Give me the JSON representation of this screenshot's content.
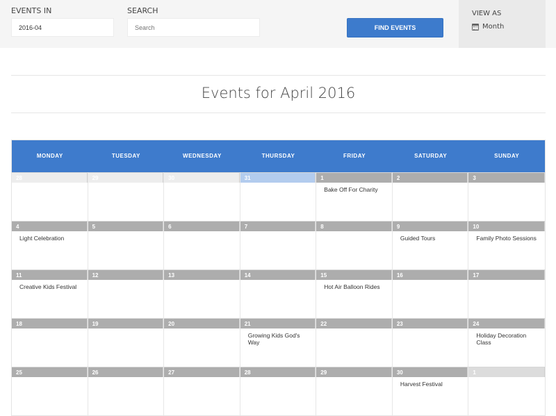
{
  "filter_bar": {
    "events_in_label": "EVENTS IN",
    "events_in_value": "2016-04",
    "search_label": "SEARCH",
    "search_placeholder": "Search",
    "find_button": "FIND EVENTS",
    "view_as_label": "VIEW AS",
    "view_as_value": "Month",
    "view_as_icon": "calendar-icon"
  },
  "page_title": "Events for April 2016",
  "colors": {
    "accent": "#3e7bcc",
    "day_header": "#adadad",
    "highlight": "#b3ccee"
  },
  "calendar": {
    "weekdays": [
      "MONDAY",
      "TUESDAY",
      "WEDNESDAY",
      "THURSDAY",
      "FRIDAY",
      "SATURDAY",
      "SUNDAY"
    ],
    "weeks": [
      [
        {
          "day": "28",
          "state": "other",
          "events": []
        },
        {
          "day": "29",
          "state": "other",
          "events": []
        },
        {
          "day": "30",
          "state": "other",
          "events": []
        },
        {
          "day": "31",
          "state": "prev-today",
          "events": []
        },
        {
          "day": "1",
          "state": "current",
          "events": [
            "Bake Off For Charity"
          ]
        },
        {
          "day": "2",
          "state": "current",
          "events": []
        },
        {
          "day": "3",
          "state": "current",
          "events": []
        }
      ],
      [
        {
          "day": "4",
          "state": "current",
          "events": [
            "Light Celebration"
          ]
        },
        {
          "day": "5",
          "state": "current",
          "events": []
        },
        {
          "day": "6",
          "state": "current",
          "events": []
        },
        {
          "day": "7",
          "state": "current",
          "events": []
        },
        {
          "day": "8",
          "state": "current",
          "events": []
        },
        {
          "day": "9",
          "state": "current",
          "events": [
            "Guided Tours"
          ]
        },
        {
          "day": "10",
          "state": "current",
          "events": [
            "Family Photo Sessions"
          ]
        }
      ],
      [
        {
          "day": "11",
          "state": "current",
          "events": [
            "Creative Kids Festival"
          ]
        },
        {
          "day": "12",
          "state": "current",
          "events": []
        },
        {
          "day": "13",
          "state": "current",
          "events": []
        },
        {
          "day": "14",
          "state": "current",
          "events": []
        },
        {
          "day": "15",
          "state": "current",
          "events": [
            "Hot Air Balloon Rides"
          ]
        },
        {
          "day": "16",
          "state": "current",
          "events": []
        },
        {
          "day": "17",
          "state": "current",
          "events": []
        }
      ],
      [
        {
          "day": "18",
          "state": "current",
          "events": []
        },
        {
          "day": "19",
          "state": "current",
          "events": []
        },
        {
          "day": "20",
          "state": "current",
          "events": []
        },
        {
          "day": "21",
          "state": "current",
          "events": [
            "Growing Kids God's Way"
          ]
        },
        {
          "day": "22",
          "state": "current",
          "events": []
        },
        {
          "day": "23",
          "state": "current",
          "events": []
        },
        {
          "day": "24",
          "state": "current",
          "events": [
            "Holiday Decoration Class"
          ]
        }
      ],
      [
        {
          "day": "25",
          "state": "current",
          "events": []
        },
        {
          "day": "26",
          "state": "current",
          "events": []
        },
        {
          "day": "27",
          "state": "current",
          "events": []
        },
        {
          "day": "28",
          "state": "current",
          "events": []
        },
        {
          "day": "29",
          "state": "current",
          "events": []
        },
        {
          "day": "30",
          "state": "current",
          "events": [
            "Harvest Festival"
          ]
        },
        {
          "day": "1",
          "state": "next",
          "events": []
        }
      ]
    ]
  }
}
